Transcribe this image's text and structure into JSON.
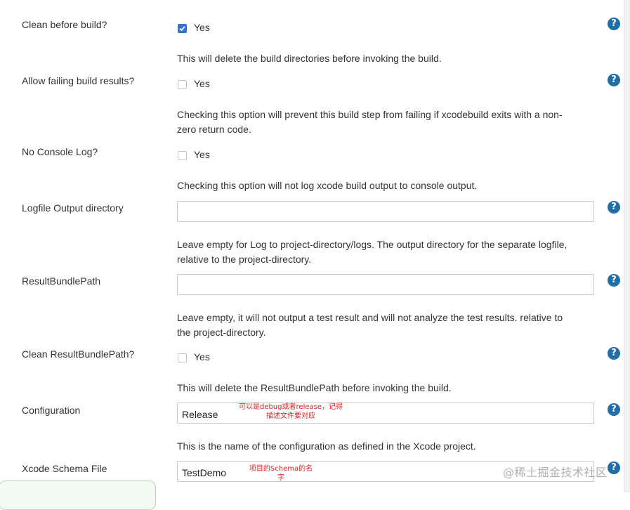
{
  "rows": {
    "clean_before_build": {
      "label": "Clean before build?",
      "checkbox_label": "Yes",
      "checked": true,
      "description": "This will delete the build directories before invoking the build."
    },
    "allow_failing": {
      "label": "Allow failing build results?",
      "checkbox_label": "Yes",
      "checked": false,
      "description_line1": "Checking this option will prevent this build step from failing if xcodebuild exits with a non-",
      "description_line2": "zero return code."
    },
    "no_console_log": {
      "label": "No Console Log?",
      "checkbox_label": "Yes",
      "checked": false,
      "description": "Checking this option will not log xcode build output to console output."
    },
    "logfile_output": {
      "label": "Logfile Output directory",
      "value": "",
      "description_line1": "Leave empty for Log to project-directory/logs. The output directory for the separate logfile,",
      "description_line2": "relative to the project-directory."
    },
    "result_bundle_path": {
      "label": "ResultBundlePath",
      "value": "",
      "description_line1": "Leave empty, it will not output a test result and will not analyze the test results. relative to",
      "description_line2": "the project-directory."
    },
    "clean_result_bundle": {
      "label": "Clean ResultBundlePath?",
      "checkbox_label": "Yes",
      "checked": false,
      "description": "This will delete the ResultBundlePath before invoking the build."
    },
    "configuration": {
      "label": "Configuration",
      "value": "Release",
      "annotation_line1": "可以是debug或者release，记得",
      "annotation_line2": "描述文件要对应",
      "description": "This is the name of the configuration as defined in the Xcode project."
    },
    "xcode_schema": {
      "label": "Xcode Schema File",
      "value": "TestDemo",
      "annotation_line1": "项目的Schema的名",
      "annotation_line2": "字"
    }
  },
  "help_icon_text": "?",
  "watermark": "@稀土掘金技术社区",
  "colors": {
    "accent": "#2f74d6",
    "help_icon": "#1d6fa8",
    "annotation": "#e02020"
  }
}
